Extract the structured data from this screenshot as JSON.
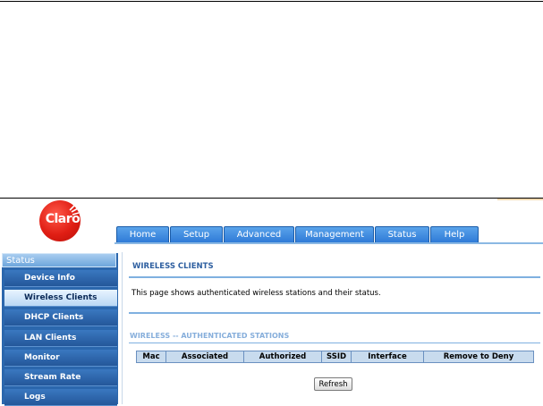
{
  "brand": {
    "logo_text": "Claro",
    "brand_color": "#e01e14"
  },
  "nav": {
    "tabs": [
      {
        "label": "Home"
      },
      {
        "label": "Setup"
      },
      {
        "label": "Advanced"
      },
      {
        "label": "Management"
      },
      {
        "label": "Status"
      },
      {
        "label": "Help"
      }
    ],
    "tab_color": "#2c78d6"
  },
  "sidebar": {
    "title": "Status",
    "items": [
      {
        "label": "Device Info",
        "active": false
      },
      {
        "label": "Wireless Clients",
        "active": true
      },
      {
        "label": "DHCP Clients",
        "active": false
      },
      {
        "label": "LAN Clients",
        "active": false
      },
      {
        "label": "Monitor",
        "active": false
      },
      {
        "label": "Stream Rate",
        "active": false
      },
      {
        "label": "Logs",
        "active": false
      }
    ]
  },
  "main": {
    "section_title": "WIRELESS CLIENTS",
    "description": "This page shows authenticated wireless stations and their status.",
    "subsection_title": "WIRELESS -- AUTHENTICATED STATIONS",
    "table": {
      "headers": [
        "Mac",
        "Associated",
        "Authorized",
        "SSID",
        "Interface",
        "Remove to Deny"
      ]
    },
    "refresh_label": "Refresh"
  }
}
